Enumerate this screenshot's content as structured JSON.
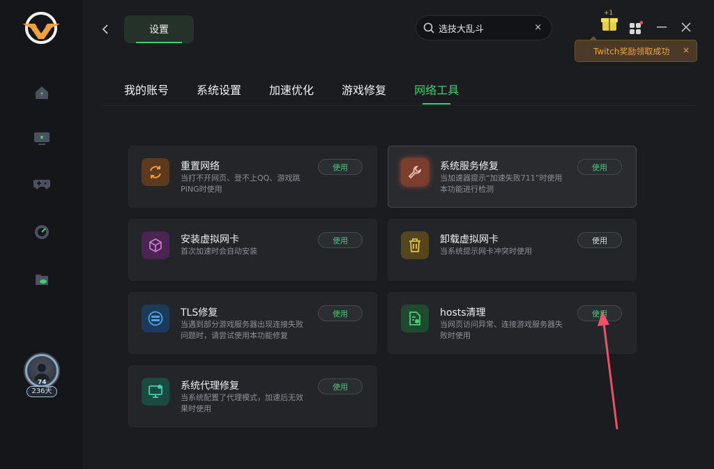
{
  "header": {
    "settings_label": "设置",
    "search_value": "选技大乱斗",
    "reward_badge": "+1"
  },
  "sidebar": {
    "level": "74",
    "days": "236天"
  },
  "toast": {
    "text": "Twitch奖励领取成功"
  },
  "tabs": [
    {
      "label": "我的账号",
      "active": false
    },
    {
      "label": "系统设置",
      "active": false
    },
    {
      "label": "加速优化",
      "active": false
    },
    {
      "label": "游戏修复",
      "active": false
    },
    {
      "label": "网络工具",
      "active": true
    }
  ],
  "tools": [
    {
      "title": "重置网络",
      "desc": "当打不开网页、登不上QQ、游戏跳PING时使用",
      "button": "使用",
      "icon": "refresh-icon",
      "icon_bg": "#5b3a1d",
      "icon_color": "#f29a3c"
    },
    {
      "title": "系统服务修复",
      "desc": "当加速器提示“加速失败711”时使用本功能进行检测",
      "button": "使用",
      "icon": "wrench-icon",
      "icon_bg": "#7a3d2e",
      "icon_color": "#f1c0b0"
    },
    {
      "title": "安装虚拟网卡",
      "desc": "首次加速时会自动安装",
      "button": "使用",
      "icon": "cube-icon",
      "icon_bg": "#4a2551",
      "icon_color": "#c97ad6"
    },
    {
      "title": "卸载虚拟网卡",
      "desc": "当系统提示网卡冲突时使用",
      "button": "使用",
      "icon": "trash-icon",
      "icon_bg": "#54461c",
      "icon_color": "#e4c342"
    },
    {
      "title": "TLS修复",
      "desc": "当遇到部分游戏服务器出现连接失败问题时，请尝试使用本功能修复",
      "button": "使用",
      "icon": "tls-icon",
      "icon_bg": "#1d3a5a",
      "icon_color": "#4fa3e8"
    },
    {
      "title": "hosts清理",
      "desc": "当网页访问异常、连接游戏服务器失败时使用",
      "button": "使用",
      "icon": "file-clean-icon",
      "icon_bg": "#1f4a2f",
      "icon_color": "#46d27a"
    },
    {
      "title": "系统代理修复",
      "desc": "当系统配置了代理模式，加速后无效果时使用",
      "button": "使用",
      "icon": "monitor-icon",
      "icon_bg": "#1c4a40",
      "icon_color": "#3fd0ad"
    }
  ],
  "colors": {
    "accent": "#3ccf73",
    "toast_text": "#f2a347",
    "annotation_arrow": "#f0506a"
  }
}
